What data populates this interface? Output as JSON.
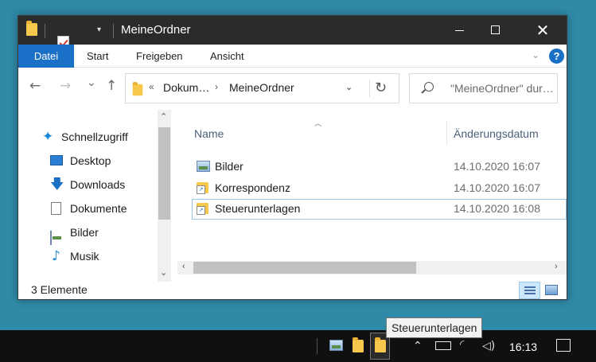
{
  "window": {
    "title": "MeineOrdner",
    "controls": {
      "minimize": "—",
      "maximize": "☐",
      "close": "✕"
    }
  },
  "ribbon": {
    "tabs": [
      {
        "label": "Datei"
      },
      {
        "label": "Start"
      },
      {
        "label": "Freigeben"
      },
      {
        "label": "Ansicht"
      }
    ],
    "help": "?"
  },
  "nav": {
    "back": "←",
    "forward": "→",
    "recent": "⌄",
    "up": "↑",
    "breadcrumb": {
      "overflow": "«",
      "parent": "Dokum…",
      "separator": "›",
      "current": "MeineOrdner"
    },
    "refresh": "↻",
    "search_placeholder": "\"MeineOrdner\" dur…"
  },
  "sidebar": {
    "items": [
      {
        "label": "Schnellzugriff",
        "icon": "star-icon",
        "pinned": false
      },
      {
        "label": "Desktop",
        "icon": "desktop-icon",
        "pinned": true
      },
      {
        "label": "Downloads",
        "icon": "download-icon",
        "pinned": true
      },
      {
        "label": "Dokumente",
        "icon": "document-icon",
        "pinned": true
      },
      {
        "label": "Bilder",
        "icon": "pictures-icon",
        "pinned": true
      },
      {
        "label": "Musik",
        "icon": "music-icon",
        "pinned": false
      }
    ],
    "pin_glyph": "📌"
  },
  "columns": {
    "name": "Name",
    "date": "Änderungsdatum"
  },
  "files": [
    {
      "name": "Bilder",
      "date": "14.10.2020 16:07",
      "icon": "library-icon"
    },
    {
      "name": "Korrespondenz",
      "date": "14.10.2020 16:07",
      "icon": "folder-shortcut-icon"
    },
    {
      "name": "Steuerunterlagen",
      "date": "14.10.2020 16:08",
      "icon": "folder-shortcut-icon",
      "selected": true
    }
  ],
  "status": {
    "count": "3 Elemente"
  },
  "taskbar": {
    "tooltip": "Steuerunterlagen",
    "clock": "16:13",
    "tray": {
      "chevron": "^",
      "volume": "🔈"
    }
  },
  "colors": {
    "accent": "#1a6fc7",
    "desktop": "#2f8aa7",
    "titlebar": "#2b2b2b",
    "taskbar": "#101010"
  }
}
